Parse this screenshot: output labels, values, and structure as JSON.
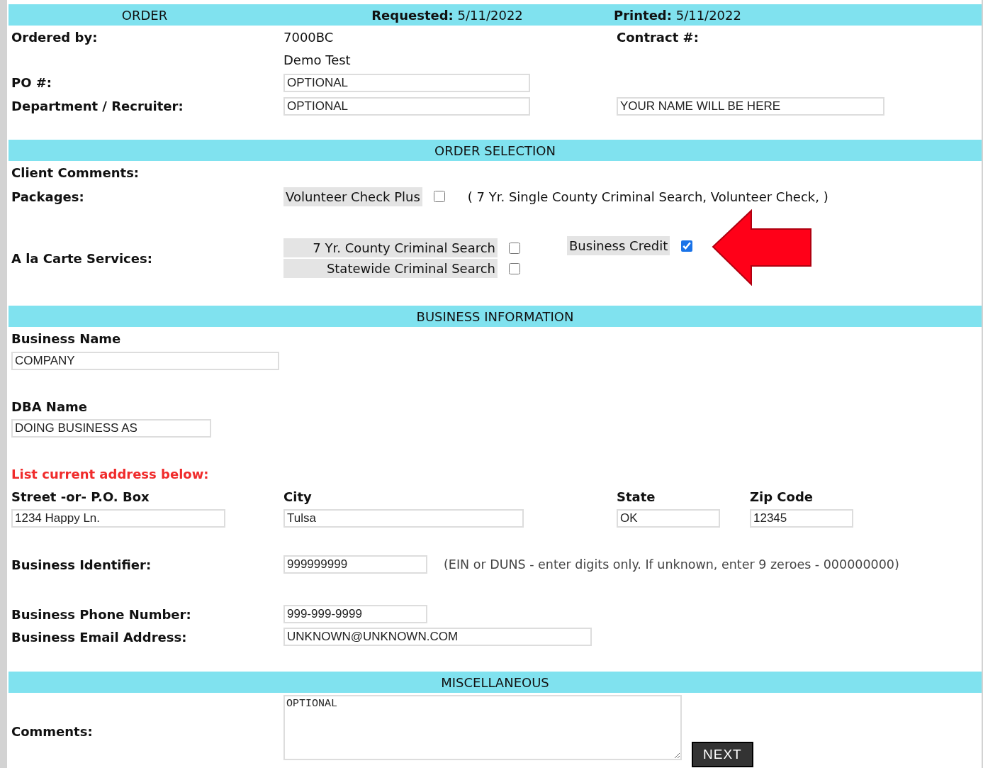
{
  "order_header": {
    "title": "ORDER",
    "requested": "**Requested:** 5/11/2022",
    "printed": "**Printed:** 5/11/2022"
  },
  "ordered_by": {
    "label": "Ordered by:",
    "values": [
      "7000BC",
      "Demo Test"
    ]
  },
  "contract": {
    "label": "Contract #:"
  },
  "po": {
    "label": "PO #:",
    "value": "OPTIONAL"
  },
  "department": {
    "label": "Department / Recruiter:",
    "value": "OPTIONAL",
    "name_value": "YOUR NAME WILL BE HERE"
  },
  "order_selection": {
    "title": "ORDER SELECTION",
    "client_comments_label": "Client Comments:",
    "packages_label": "Packages:",
    "packages": [
      {
        "label": "Volunteer Check Plus",
        "checked": false,
        "contents": "( 7 Yr. Single County Criminal Search, Volunteer Check, )"
      }
    ],
    "a_la_carte_label": "A la Carte Services:",
    "services": [
      {
        "label": "7 Yr. County Criminal Search",
        "checked": false
      },
      {
        "label": "Statewide Criminal Search",
        "checked": false
      },
      {
        "label": "Business Credit",
        "checked": true
      }
    ]
  },
  "business_information": {
    "title": "BUSINESS INFORMATION",
    "business_name": {
      "label": "Business Name",
      "value": "COMPANY"
    },
    "dba_name": {
      "label": "DBA Name",
      "value": "DOING BUSINESS AS"
    },
    "address_note": "List current address below:",
    "street": {
      "label": "Street -or- P.O. Box",
      "value": "1234 Happy Ln."
    },
    "city": {
      "label": "City",
      "value": "Tulsa"
    },
    "state": {
      "label": "State",
      "value": "OK"
    },
    "zip": {
      "label": "Zip Code",
      "value": "12345"
    },
    "identifier": {
      "label": "Business Identifier:",
      "value": "999999999",
      "hint": "(EIN or DUNS - enter digits only. If unknown, enter 9 zeroes - 000000000)"
    },
    "phone": {
      "label": "Business Phone Number:",
      "value": "999-999-9999"
    },
    "email": {
      "label": "Business Email Address:",
      "value": "UNKNOWN@UNKNOWN.COM"
    }
  },
  "miscellaneous": {
    "title": "MISCELLANEOUS",
    "comments_label": "Comments:",
    "comments_value": "OPTIONAL"
  },
  "next_button": "NEXT"
}
